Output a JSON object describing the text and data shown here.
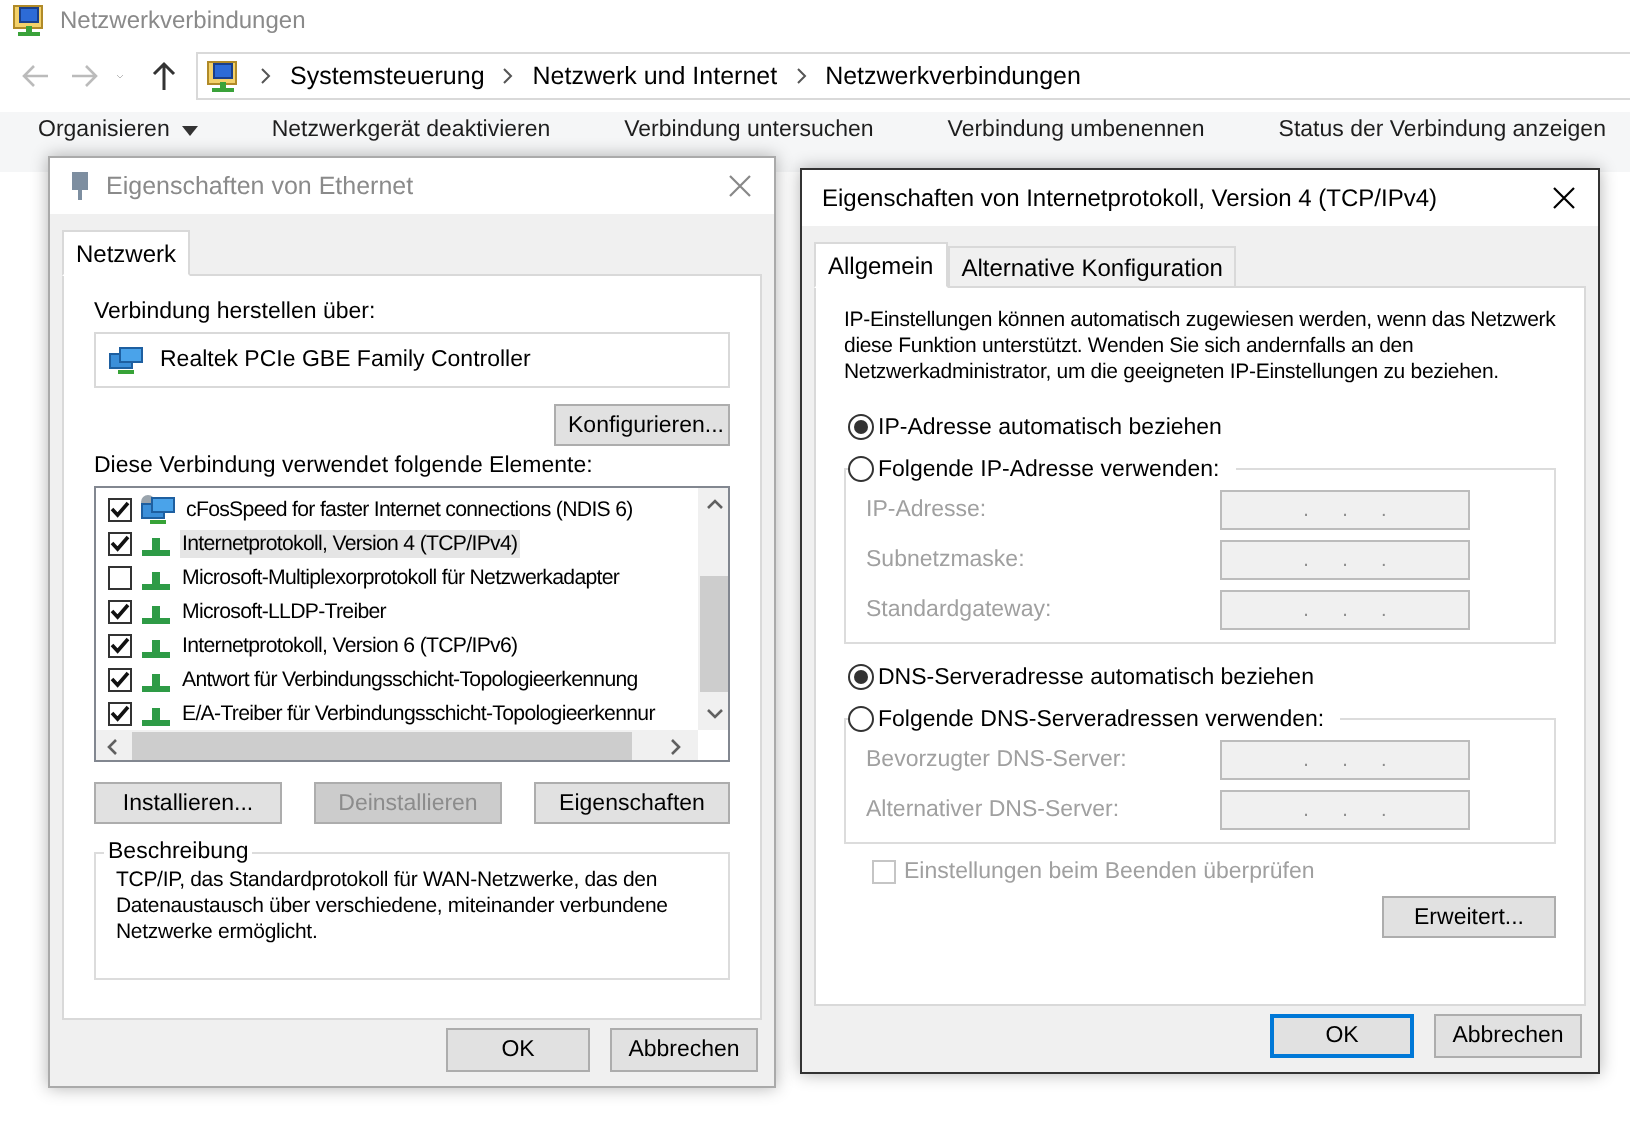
{
  "explorer": {
    "title": "Netzwerkverbindungen",
    "breadcrumb": [
      "Systemsteuerung",
      "Netzwerk und Internet",
      "Netzwerkverbindungen"
    ],
    "toolbar": [
      {
        "label": "Organisieren",
        "menu": true
      },
      {
        "label": "Netzwerkgerät deaktivieren",
        "menu": false
      },
      {
        "label": "Verbindung untersuchen",
        "menu": false
      },
      {
        "label": "Verbindung umbenennen",
        "menu": false
      },
      {
        "label": "Status der Verbindung anzeigen",
        "menu": false
      }
    ]
  },
  "ethernet_dialog": {
    "title": "Eigenschaften von Ethernet",
    "active": false,
    "tabs": [
      {
        "label": "Netzwerk",
        "selected": true
      }
    ],
    "connect_label": "Verbindung herstellen über:",
    "adapter": "Realtek PCIe GBE Family Controller",
    "configure_button": "Konfigurieren...",
    "items_label": "Diese Verbindung verwendet folgende Elemente:",
    "items": [
      {
        "label": "cFosSpeed for faster Internet connections (NDIS 6)",
        "kind": "service",
        "checked": true,
        "selected": false
      },
      {
        "label": "Internetprotokoll, Version 4 (TCP/IPv4)",
        "kind": "protocol",
        "checked": true,
        "selected": true
      },
      {
        "label": "Microsoft-Multiplexorprotokoll für Netzwerkadapter",
        "kind": "protocol",
        "checked": false,
        "selected": false
      },
      {
        "label": "Microsoft-LLDP-Treiber",
        "kind": "protocol",
        "checked": true,
        "selected": false
      },
      {
        "label": "Internetprotokoll, Version 6 (TCP/IPv6)",
        "kind": "protocol",
        "checked": true,
        "selected": false
      },
      {
        "label": "Antwort für Verbindungsschicht-Topologieerkennung",
        "kind": "protocol",
        "checked": true,
        "selected": false
      },
      {
        "label": "E/A-Treiber für Verbindungsschicht-Topologieerkennur",
        "kind": "protocol",
        "checked": true,
        "selected": false
      }
    ],
    "buttons": [
      {
        "label": "Installieren...",
        "disabled": false
      },
      {
        "label": "Deinstallieren",
        "disabled": true
      },
      {
        "label": "Eigenschaften",
        "disabled": false
      }
    ],
    "description": {
      "title": "Beschreibung",
      "text": "TCP/IP, das Standardprotokoll für WAN-Netzwerke, das den Datenaustausch über verschiedene, miteinander verbundene Netzwerke ermöglicht."
    },
    "footer_buttons": [
      {
        "label": "OK",
        "focused": false
      },
      {
        "label": "Abbrechen",
        "focused": false
      }
    ]
  },
  "ipv4_dialog": {
    "title": "Eigenschaften von Internetprotokoll, Version 4 (TCP/IPv4)",
    "active": true,
    "tabs": [
      {
        "label": "Allgemein",
        "selected": true
      },
      {
        "label": "Alternative Konfiguration",
        "selected": false
      }
    ],
    "intro": "IP-Einstellungen können automatisch zugewiesen werden, wenn das Netzwerk diese Funktion unterstützt. Wenden Sie sich andernfalls an den Netzwerkadministrator, um die geeigneten IP-Einstellungen zu beziehen.",
    "ip_options": [
      {
        "label": "IP-Adresse automatisch beziehen",
        "selected": true
      },
      {
        "label": "Folgende IP-Adresse verwenden:",
        "selected": false
      }
    ],
    "ip_fields": [
      {
        "label": "IP-Adresse:",
        "value": ".      .      ."
      },
      {
        "label": "Subnetzmaske:",
        "value": ".      .      ."
      },
      {
        "label": "Standardgateway:",
        "value": ".      .      ."
      }
    ],
    "dns_options": [
      {
        "label": "DNS-Serveradresse automatisch beziehen",
        "selected": true
      },
      {
        "label": "Folgende DNS-Serveradressen verwenden:",
        "selected": false
      }
    ],
    "dns_fields": [
      {
        "label": "Bevorzugter DNS-Server:",
        "value": ".      .      ."
      },
      {
        "label": "Alternativer DNS-Server:",
        "value": ".      .      ."
      }
    ],
    "validate": {
      "label": "Einstellungen beim Beenden überprüfen",
      "checked": false,
      "disabled": true
    },
    "advanced_button": "Erweitert...",
    "footer_buttons": [
      {
        "label": "OK",
        "focused": true
      },
      {
        "label": "Abbrechen",
        "focused": false
      }
    ]
  }
}
